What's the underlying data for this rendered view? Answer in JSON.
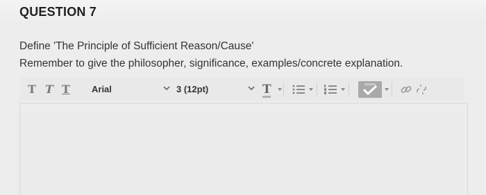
{
  "question": {
    "title": "QUESTION 7",
    "prompt_line1": "Define 'The Principle of Sufficient Reason/Cause'",
    "prompt_line2": "Remember to give the philosopher, significance, examples/concrete explanation."
  },
  "toolbar": {
    "bold_label": "T",
    "italic_label": "T",
    "underline_label": "T",
    "font_family": "Arial",
    "font_size": "3 (12pt)",
    "text_color_label": "T",
    "icons": [
      "text-color-icon",
      "unordered-list-icon",
      "ordered-list-icon",
      "spellcheck-icon",
      "link-icon",
      "unlink-icon"
    ]
  },
  "colors": {
    "background": "#ebebeb",
    "toolbar_icon": "#7a7a7a",
    "spellcheck_bg": "#a9a9a9"
  }
}
